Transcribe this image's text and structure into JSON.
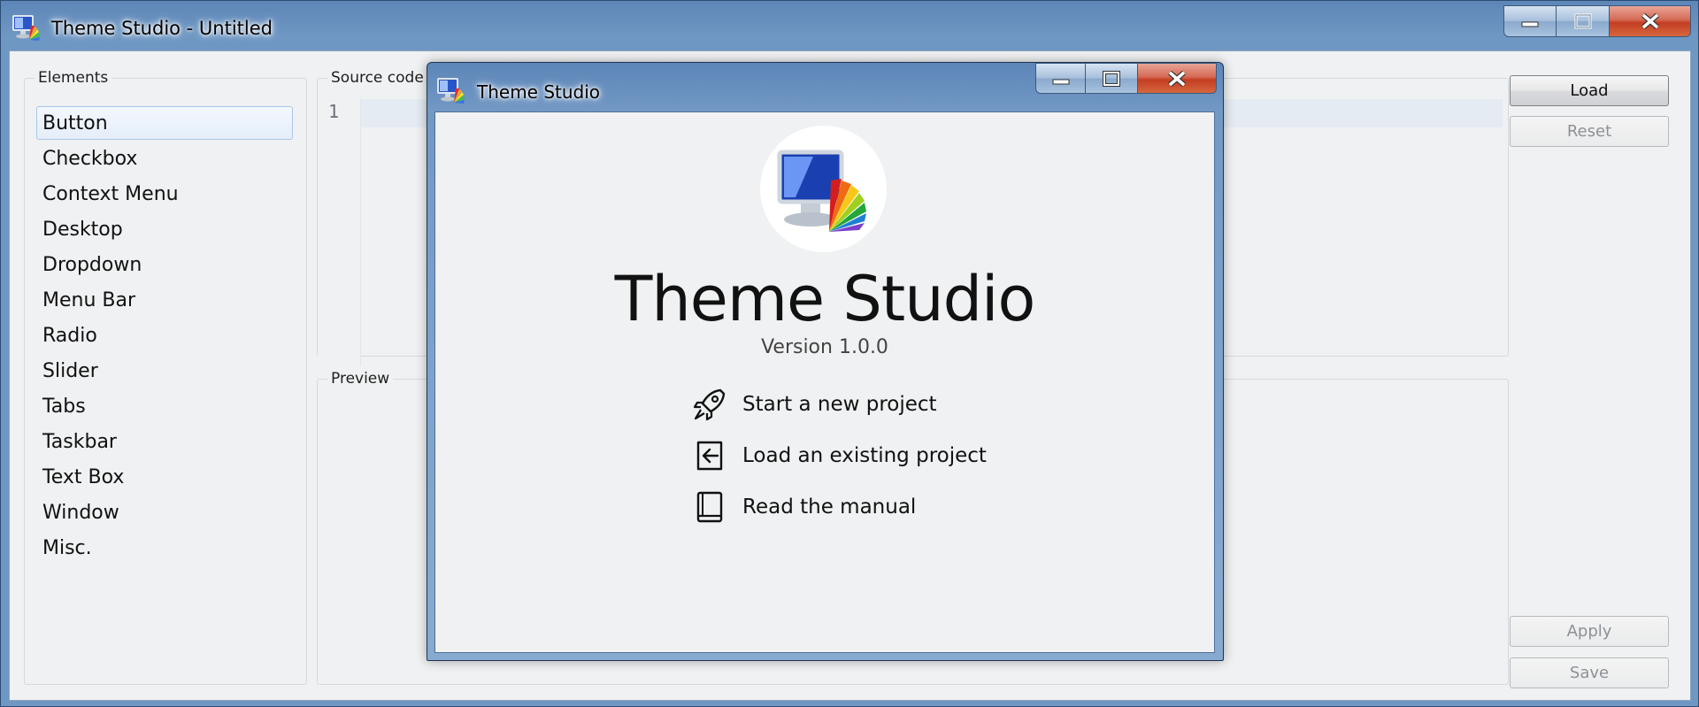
{
  "window": {
    "title": "Theme Studio - Untitled",
    "icon": "theme-studio-icon"
  },
  "elements_panel": {
    "legend": "Elements",
    "items": [
      {
        "label": "Button",
        "selected": true
      },
      {
        "label": "Checkbox"
      },
      {
        "label": "Context Menu"
      },
      {
        "label": "Desktop"
      },
      {
        "label": "Dropdown"
      },
      {
        "label": "Menu Bar"
      },
      {
        "label": "Radio"
      },
      {
        "label": "Slider"
      },
      {
        "label": "Tabs"
      },
      {
        "label": "Taskbar"
      },
      {
        "label": "Text Box"
      },
      {
        "label": "Window"
      },
      {
        "label": "Misc."
      }
    ]
  },
  "source_code": {
    "legend": "Source code",
    "line_numbers": [
      "1"
    ]
  },
  "preview": {
    "legend": "Preview"
  },
  "buttons": {
    "load": "Load",
    "reset": "Reset",
    "apply": "Apply",
    "save": "Save"
  },
  "dialog": {
    "title": "Theme Studio",
    "heading": "Theme Studio",
    "version": "Version 1.0.0",
    "actions": [
      {
        "label": "Start a new project",
        "icon": "rocket-icon"
      },
      {
        "label": "Load an existing project",
        "icon": "import-icon"
      },
      {
        "label": "Read the manual",
        "icon": "book-icon"
      }
    ]
  },
  "colors": {
    "titlebar": "#6f97c3",
    "close_button": "#c33d22",
    "selection_border": "#a9c6ea"
  }
}
